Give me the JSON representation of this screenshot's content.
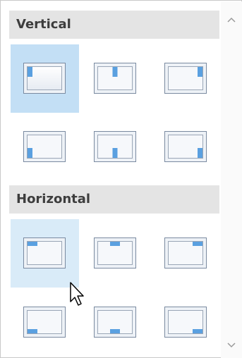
{
  "sections": {
    "vertical": {
      "title": "Vertical",
      "options": [
        {
          "name": "top-left"
        },
        {
          "name": "top-center"
        },
        {
          "name": "top-right"
        },
        {
          "name": "bottom-left"
        },
        {
          "name": "bottom-center"
        },
        {
          "name": "bottom-right"
        }
      ],
      "selected": "top-left"
    },
    "horizontal": {
      "title": "Horizontal",
      "options": [
        {
          "name": "top-left"
        },
        {
          "name": "top-center"
        },
        {
          "name": "top-right"
        },
        {
          "name": "bottom-left"
        },
        {
          "name": "bottom-center"
        },
        {
          "name": "bottom-right"
        }
      ],
      "hovered": "top-left"
    }
  },
  "colors": {
    "header_bg": "#e4e4e4",
    "selected_bg": "#c3dff5",
    "hover_bg": "#d9ebf8",
    "accent_blue": "#5aa0e0",
    "frame_border": "#7a8aa0"
  },
  "icons": {
    "scroll_up": "chevron-up-icon",
    "scroll_down": "chevron-down-icon",
    "cursor": "mouse-pointer-icon"
  }
}
